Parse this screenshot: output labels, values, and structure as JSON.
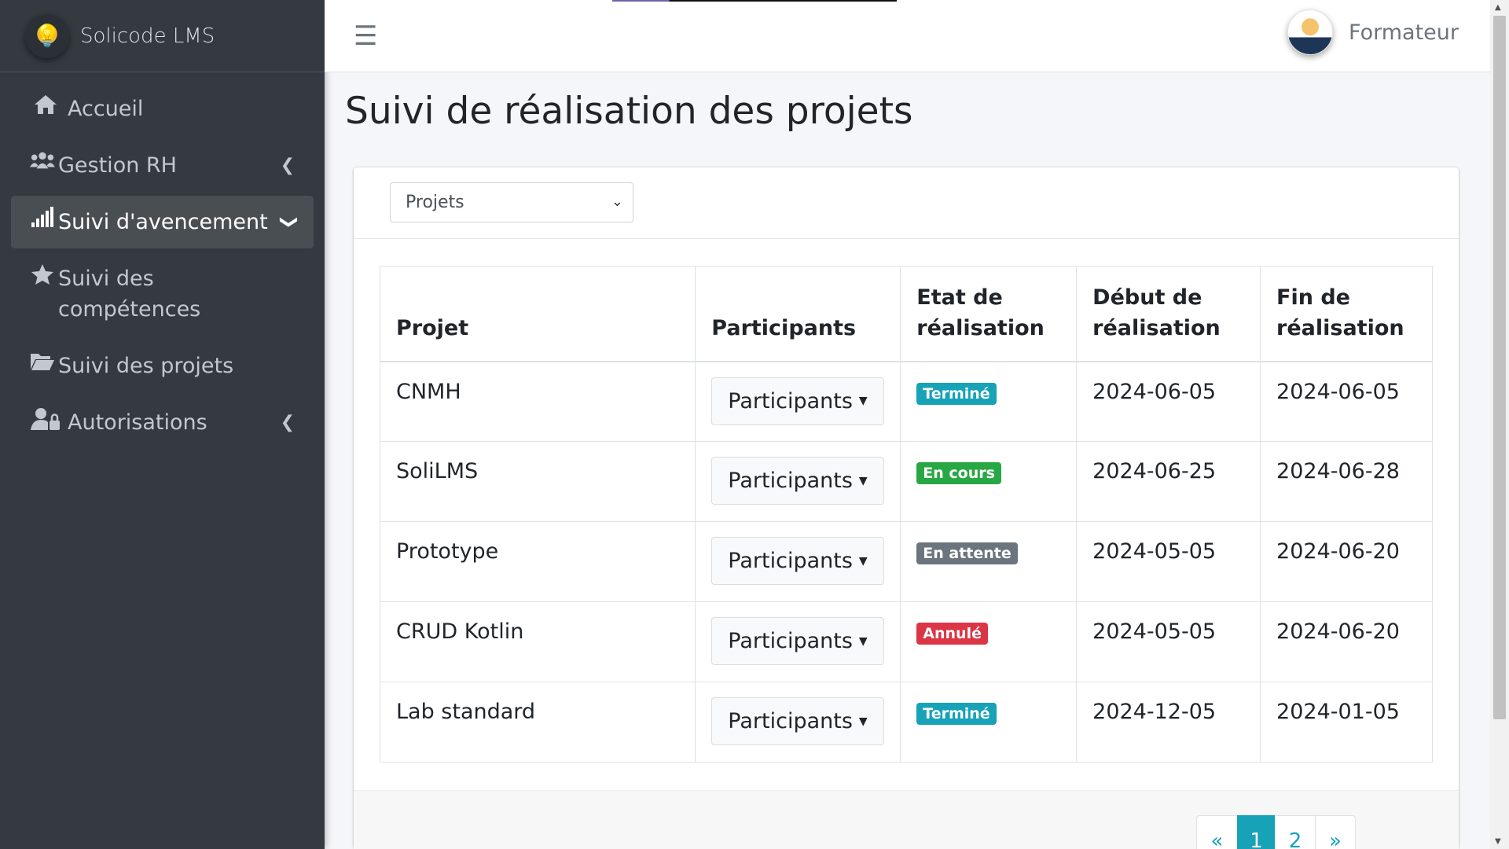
{
  "sidebar": {
    "brand": "Solicode LMS",
    "items": [
      {
        "label": "Accueil",
        "icon": "home-icon"
      },
      {
        "label": "Gestion RH",
        "icon": "users-icon"
      },
      {
        "label": "Suivi d'avencement",
        "icon": "signal-icon"
      },
      {
        "label": "Suivi des compétences",
        "icon": "star-icon"
      },
      {
        "label": "Suivi des projets",
        "icon": "folder-open-icon"
      },
      {
        "label": "Autorisations",
        "icon": "user-lock-icon"
      }
    ]
  },
  "header": {
    "user_name": "Formateur"
  },
  "main": {
    "title": "Suivi de réalisation des projets",
    "filter": {
      "selected": "Projets"
    },
    "table": {
      "columns": [
        "Projet",
        "Participants",
        "Etat de réalisation",
        "Début de réalisation",
        "Fin de réalisation"
      ],
      "participants_button": "Participants",
      "rows": [
        {
          "projet": "CNMH",
          "etat": "Terminé",
          "etat_color": "#17a2b8",
          "debut": "2024-06-05",
          "fin": "2024-06-05"
        },
        {
          "projet": "SoliLMS",
          "etat": "En cours",
          "etat_color": "#28a745",
          "debut": "2024-06-25",
          "fin": "2024-06-28"
        },
        {
          "projet": "Prototype",
          "etat": "En attente",
          "etat_color": "#6c757d",
          "debut": "2024-05-05",
          "fin": "2024-06-20"
        },
        {
          "projet": "CRUD Kotlin",
          "etat": "Annulé",
          "etat_color": "#dc3545",
          "debut": "2024-05-05",
          "fin": "2024-06-20"
        },
        {
          "projet": "Lab standard",
          "etat": "Terminé",
          "etat_color": "#17a2b8",
          "debut": "2024-12-05",
          "fin": "2024-01-05"
        }
      ]
    },
    "pagination": {
      "prev": "«",
      "pages": [
        "1",
        "2"
      ],
      "current": "1",
      "next": "»"
    }
  },
  "colors": {
    "sidebar_bg": "#343a40",
    "accent": "#17a2b8"
  }
}
